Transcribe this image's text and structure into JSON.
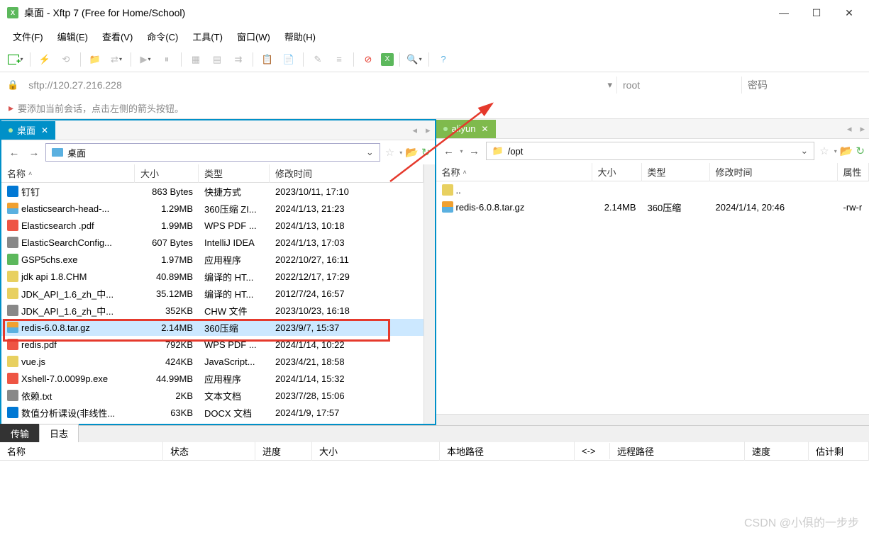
{
  "window": {
    "title": "桌面 - Xftp 7 (Free for Home/School)"
  },
  "menu": {
    "file": "文件(F)",
    "edit": "编辑(E)",
    "view": "查看(V)",
    "command": "命令(C)",
    "tools": "工具(T)",
    "window": "窗口(W)",
    "help": "帮助(H)"
  },
  "address": {
    "url": "sftp://120.27.216.228",
    "user": "root",
    "password_placeholder": "密码"
  },
  "flag_message": "要添加当前会话，点击左侧的箭头按钮。",
  "left_pane": {
    "tab_label": "桌面",
    "path": "桌面",
    "columns": {
      "name": "名称",
      "size": "大小",
      "type": "类型",
      "modified": "修改时间"
    },
    "files": [
      {
        "name": "钉钉",
        "size": "863 Bytes",
        "type": "快捷方式",
        "modified": "2023/10/11, 17:10",
        "ico": "ico-blue"
      },
      {
        "name": "elasticsearch-head-...",
        "size": "1.29MB",
        "type": "360压缩 ZI...",
        "modified": "2024/1/13, 21:23",
        "ico": "ico-archive"
      },
      {
        "name": "Elasticsearch .pdf",
        "size": "1.99MB",
        "type": "WPS PDF ...",
        "modified": "2024/1/13, 10:18",
        "ico": "ico-red"
      },
      {
        "name": "ElasticSearchConfig...",
        "size": "607 Bytes",
        "type": "IntelliJ IDEA",
        "modified": "2024/1/13, 17:03",
        "ico": "ico-gray"
      },
      {
        "name": "GSP5chs.exe",
        "size": "1.97MB",
        "type": "应用程序",
        "modified": "2022/10/27, 16:11",
        "ico": "ico-green"
      },
      {
        "name": "jdk api 1.8.CHM",
        "size": "40.89MB",
        "type": "编译的 HT...",
        "modified": "2022/12/17, 17:29",
        "ico": "ico-yellow"
      },
      {
        "name": "JDK_API_1.6_zh_中...",
        "size": "35.12MB",
        "type": "编译的 HT...",
        "modified": "2012/7/24, 16:57",
        "ico": "ico-yellow"
      },
      {
        "name": "JDK_API_1.6_zh_中...",
        "size": "352KB",
        "type": "CHW 文件",
        "modified": "2023/10/23, 16:18",
        "ico": "ico-gray"
      },
      {
        "name": "redis-6.0.8.tar.gz",
        "size": "2.14MB",
        "type": "360压缩",
        "modified": "2023/9/7, 15:37",
        "ico": "ico-archive",
        "selected": true
      },
      {
        "name": "redis.pdf",
        "size": "792KB",
        "type": "WPS PDF ...",
        "modified": "2024/1/14, 10:22",
        "ico": "ico-red"
      },
      {
        "name": "vue.js",
        "size": "424KB",
        "type": "JavaScript...",
        "modified": "2023/4/21, 18:58",
        "ico": "ico-yellow"
      },
      {
        "name": "Xshell-7.0.0099p.exe",
        "size": "44.99MB",
        "type": "应用程序",
        "modified": "2024/1/14, 15:32",
        "ico": "ico-red"
      },
      {
        "name": "依赖.txt",
        "size": "2KB",
        "type": "文本文档",
        "modified": "2023/7/28, 15:06",
        "ico": "ico-gray"
      },
      {
        "name": "数值分析课设(非线性...",
        "size": "63KB",
        "type": "DOCX 文档",
        "modified": "2024/1/9, 17:57",
        "ico": "ico-blue"
      }
    ]
  },
  "right_pane": {
    "tab_label": "aliyun",
    "path": "/opt",
    "columns": {
      "name": "名称",
      "size": "大小",
      "type": "类型",
      "modified": "修改时间",
      "attr": "属性"
    },
    "files": [
      {
        "name": "..",
        "size": "",
        "type": "",
        "modified": "",
        "ico": "ico-yellow"
      },
      {
        "name": "redis-6.0.8.tar.gz",
        "size": "2.14MB",
        "type": "360压缩",
        "modified": "2024/1/14, 20:46",
        "attr": "-rw-r",
        "ico": "ico-archive"
      }
    ]
  },
  "bottom": {
    "tab_transfer": "传输",
    "tab_log": "日志",
    "columns": {
      "name": "名称",
      "status": "状态",
      "progress": "进度",
      "size": "大小",
      "local": "本地路径",
      "dir": "<->",
      "remote": "远程路径",
      "speed": "速度",
      "est": "估计剩"
    }
  },
  "watermark": "CSDN @小俱的一步步"
}
